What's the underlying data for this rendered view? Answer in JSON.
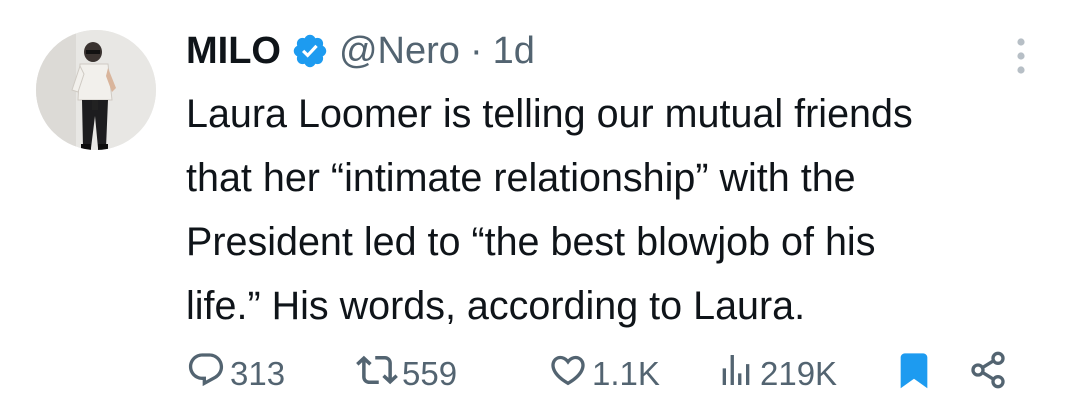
{
  "user": {
    "display_name": "MILO",
    "handle": "@Nero",
    "separator": "·",
    "time": "1d"
  },
  "tweet": {
    "lines": [
      "Laura Loomer is telling our mutual friends",
      "that her “intimate relationship” with the",
      "President led to “the best blowjob of his",
      "life.” His words, according to Laura."
    ]
  },
  "actions": {
    "replies": "313",
    "reposts": "559",
    "likes": "1.1K",
    "views": "219K"
  },
  "icons": {
    "verified": "verified-badge-icon",
    "more": "more-vertical-icon",
    "reply": "reply-bubble-icon",
    "repost": "repost-arrows-icon",
    "like": "heart-icon",
    "views": "views-bars-icon",
    "bookmark": "bookmark-icon",
    "share": "share-icon"
  },
  "colors": {
    "accent": "#1d9bf0",
    "text": "#0f1419",
    "muted": "#536471"
  }
}
